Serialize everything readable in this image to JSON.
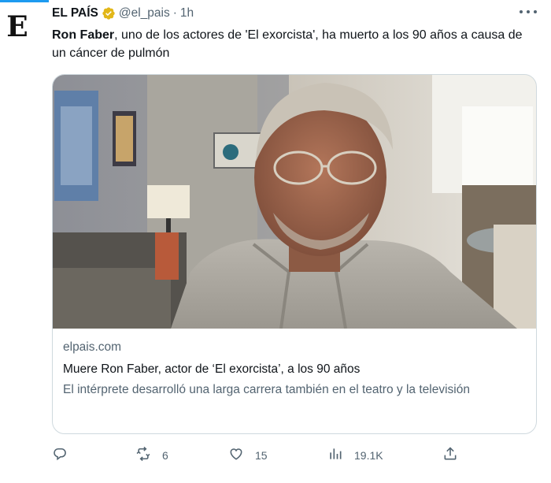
{
  "tweet": {
    "avatar_letter": "E",
    "author_name": "EL PAÍS",
    "handle": "@el_pais",
    "separator": "·",
    "time": "1h",
    "text_bold": "Ron Faber",
    "text_rest": ", uno de los actores de 'El exorcista', ha muerto a los 90 años a causa de un cáncer de pulmón"
  },
  "card": {
    "domain": "elpais.com",
    "title": "Muere Ron Faber, actor de ‘El exorcista’, a los 90 años",
    "description": "El intérprete desarrolló una larga carrera también en el teatro y la televisión"
  },
  "actions": {
    "reply_count": "",
    "retweet_count": "6",
    "like_count": "15",
    "views_count": "19.1K"
  },
  "colors": {
    "accent": "#1d9bf0",
    "verified_badge": "#e2b719",
    "muted": "#536471",
    "border": "#cfd9de"
  },
  "icons": [
    "verified-badge-icon",
    "more-options-icon",
    "reply-icon",
    "retweet-icon",
    "like-icon",
    "views-icon",
    "share-icon"
  ]
}
